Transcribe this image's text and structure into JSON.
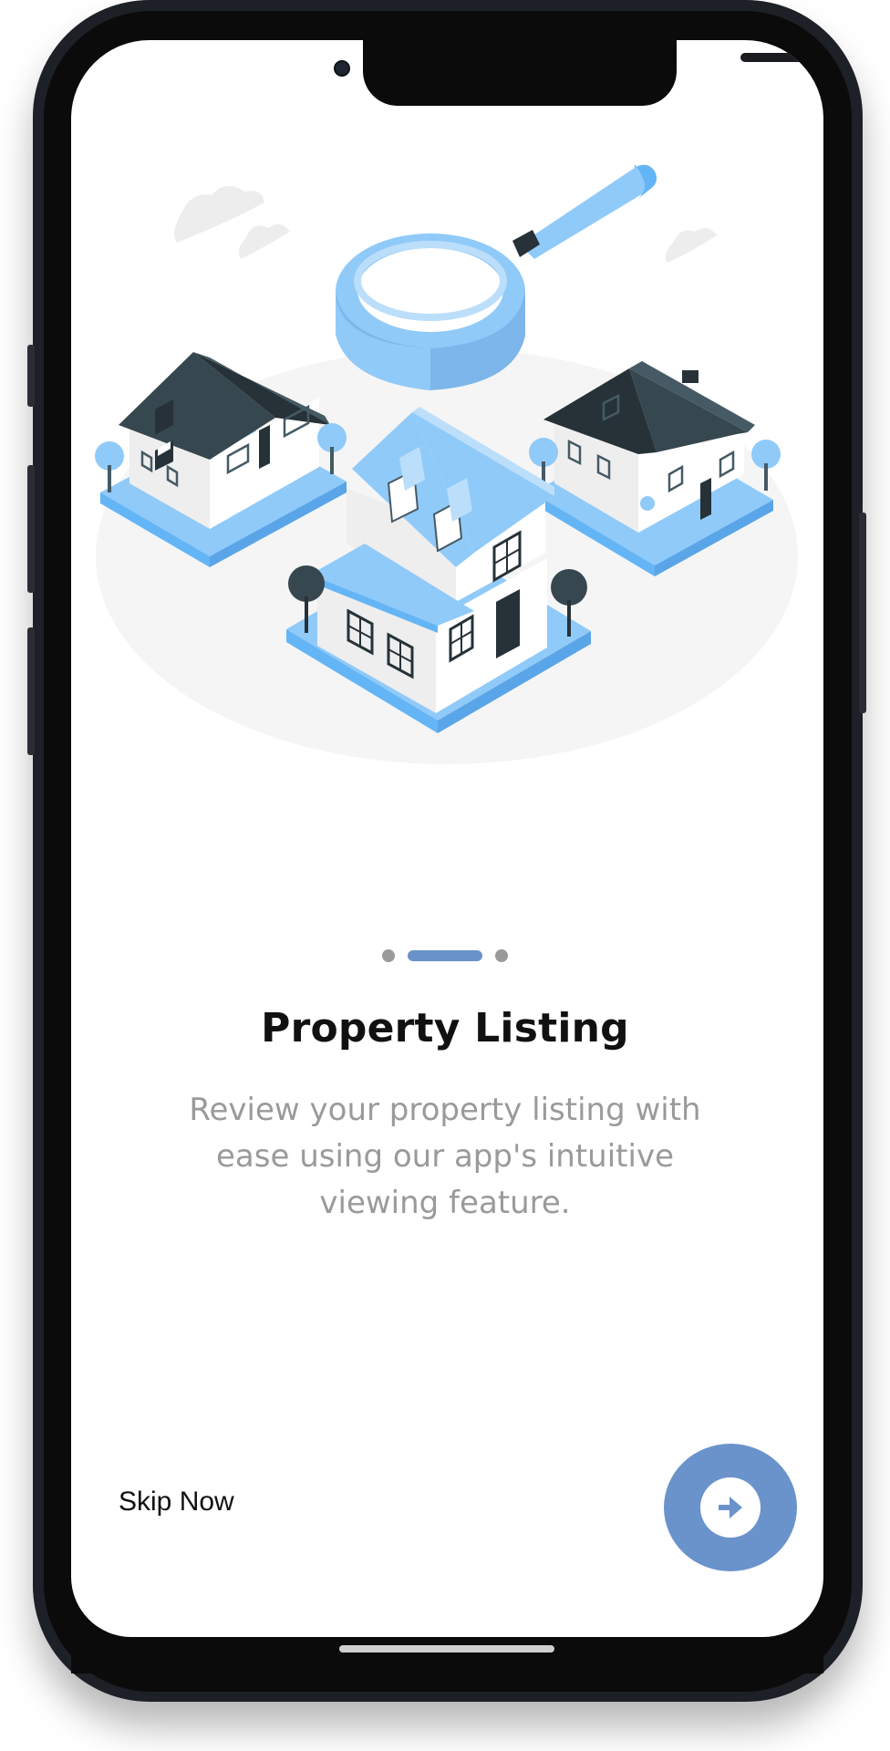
{
  "onboarding": {
    "title": "Property Listing",
    "description": "Review your property listing with ease using our app's intuitive viewing feature.",
    "pager": {
      "total": 3,
      "active_index": 1
    },
    "skip_label": "Skip Now",
    "next_icon": "arrow-right-icon",
    "illustration_icon": "houses-magnifier-illustration"
  },
  "colors": {
    "accent": "#6a93cc",
    "illustration_blue": "#90caf9",
    "roof_dark": "#37474f",
    "text_primary": "#111111",
    "text_secondary": "#9a9a9a"
  }
}
